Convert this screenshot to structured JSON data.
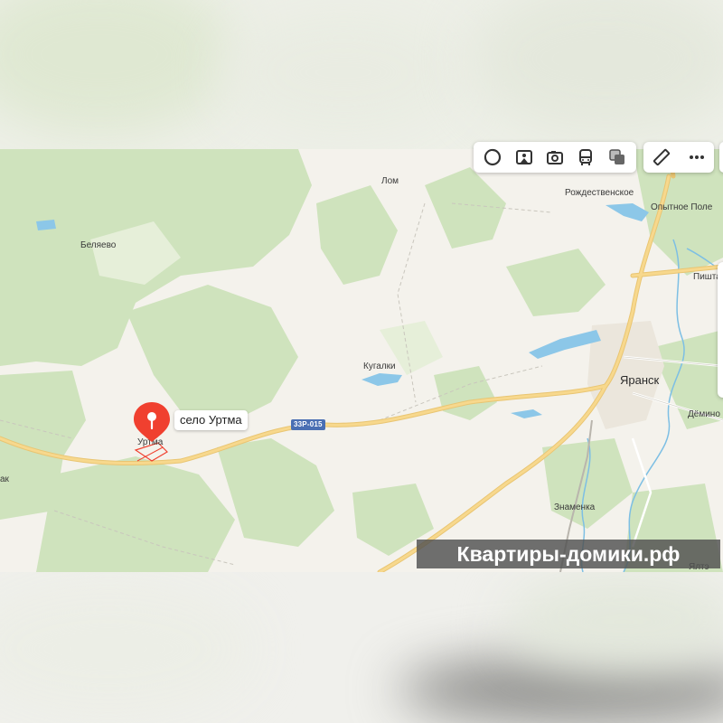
{
  "toolbar": {
    "main_icons": [
      "layers-icon",
      "panorama-icon",
      "camera-icon",
      "transit-icon",
      "traffic-icon"
    ],
    "tool_icons": [
      "ruler-icon",
      "more-icon"
    ]
  },
  "places": {
    "lom": "Лом",
    "rozhdestvenskoe": "Рождественское",
    "opytnoe_pole": "Опытное Поле",
    "belyaevo": "Беляево",
    "pishta": "Пишта",
    "kugalki": "Кугалки",
    "yaransk": "Яранск",
    "demino": "Дёмино",
    "urtma": "Уртма",
    "znamenka": "Знаменка",
    "edge_left": "ак",
    "edge_bottom_right": "Ялтэ"
  },
  "roads": {
    "r1": "33Р-015"
  },
  "marker": {
    "label": "село Уртма",
    "icon": "pin-icon",
    "color": "#f0402f"
  },
  "watermark": {
    "text": "Квартиры-домики.рф"
  },
  "colors": {
    "forest": "#cfe3bd",
    "road_major": "#f7d88d",
    "water": "#8cc7e8",
    "marker": "#f0402f",
    "badge": "#4a6fb3"
  }
}
